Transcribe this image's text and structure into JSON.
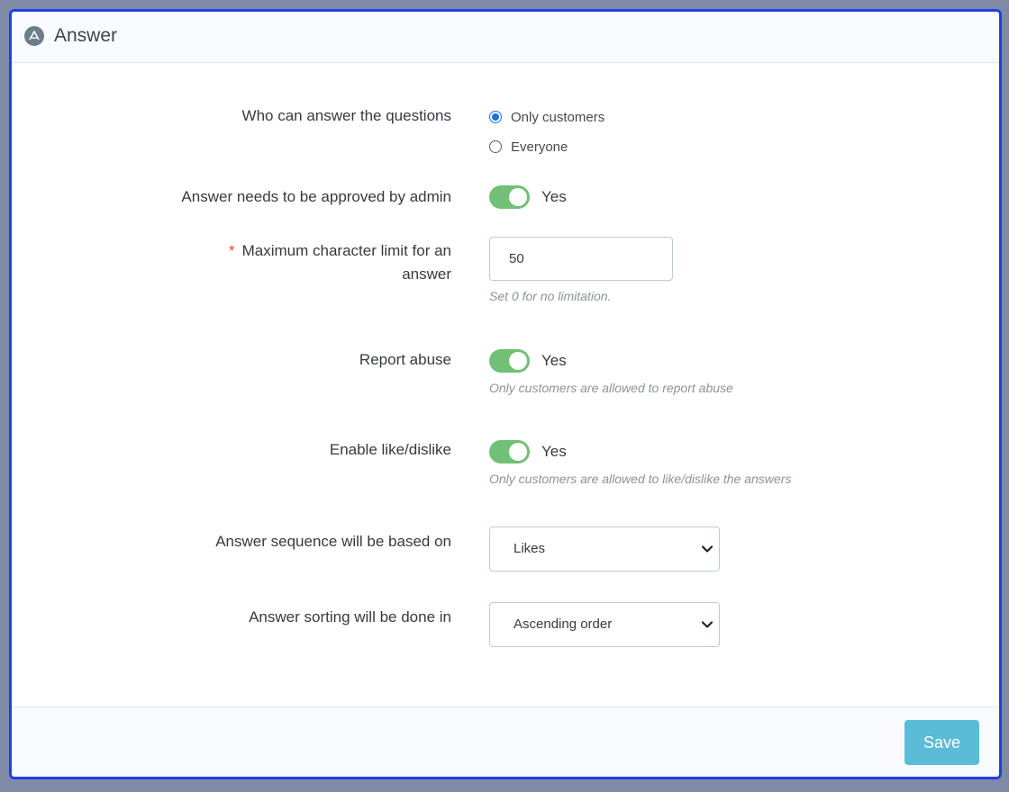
{
  "header": {
    "title": "Answer",
    "icon": "collapse-icon"
  },
  "fields": {
    "who_can_answer": {
      "label": "Who can answer the questions",
      "options": [
        "Only customers",
        "Everyone"
      ],
      "selected": "Only customers"
    },
    "approval": {
      "label": "Answer needs to be approved by admin",
      "value": "Yes"
    },
    "char_limit": {
      "label_line1": "Maximum character limit for an",
      "label_line2": "answer",
      "required_mark": "*",
      "value": "50",
      "help": "Set 0 for no limitation."
    },
    "report_abuse": {
      "label": "Report abuse",
      "value": "Yes",
      "help": "Only customers are allowed to report abuse"
    },
    "like_dislike": {
      "label": "Enable like/dislike",
      "value": "Yes",
      "help": "Only customers are allowed to like/dislike the answers"
    },
    "sequence": {
      "label": "Answer sequence will be based on",
      "value": "Likes"
    },
    "sorting": {
      "label": "Answer sorting will be done in",
      "value": "Ascending order"
    }
  },
  "footer": {
    "save_label": "Save"
  },
  "colors": {
    "accent": "#1a73e8",
    "switch_on": "#70c075",
    "save_button": "#5bbcd8",
    "panel_border": "#2140e0",
    "required": "#e04a2c"
  }
}
